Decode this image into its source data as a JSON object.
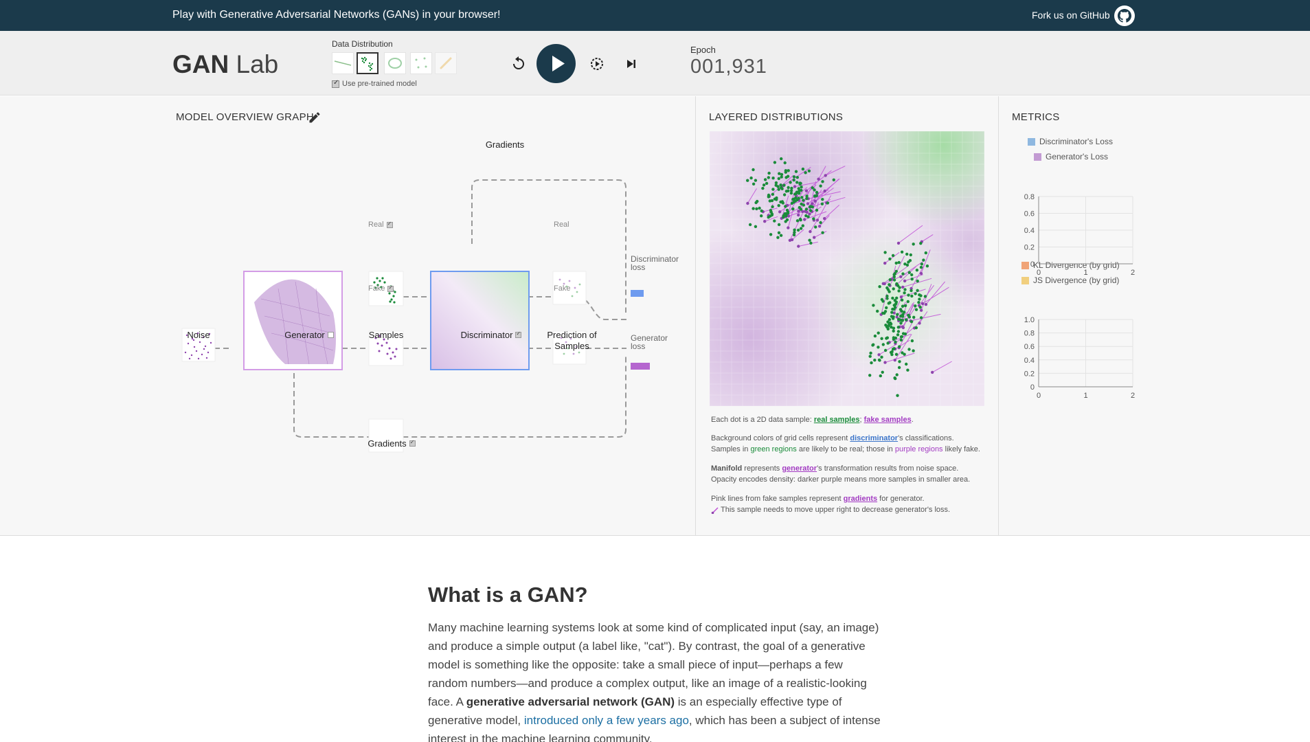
{
  "banner": {
    "message": "Play with Generative Adversarial Networks (GANs) in your browser!",
    "fork_label": "Fork us on GitHub",
    "fork_icon": "github-icon"
  },
  "header": {
    "logo_bold": "GAN",
    "logo_light": "Lab",
    "data_distribution_label": "Data Distribution",
    "distributions": [
      {
        "name": "line",
        "icon": "line-distribution-icon",
        "selected": false
      },
      {
        "name": "two-clusters",
        "icon": "two-clusters-distribution-icon",
        "selected": true
      },
      {
        "name": "ring",
        "icon": "ring-distribution-icon",
        "selected": false
      },
      {
        "name": "gaussian-mixture",
        "icon": "gaussian-mixture-distribution-icon",
        "selected": false
      },
      {
        "name": "draw",
        "icon": "pencil-draw-icon",
        "selected": false
      }
    ],
    "pretrained_label": "Use pre-trained model",
    "controls": [
      "reset-icon",
      "play-icon",
      "slow-motion-icon",
      "step-icon"
    ],
    "epoch_label": "Epoch",
    "epoch_value": "001,931"
  },
  "model_overview": {
    "title": "MODEL OVERVIEW GRAPH",
    "edit_icon": "pencil-icon",
    "nodes": {
      "noise": "Noise",
      "generator": "Generator",
      "samples": "Samples",
      "discriminator": "Discriminator",
      "prediction_line1": "Prediction of",
      "prediction_line2": "Samples",
      "gradients_top": "Gradients",
      "gradients_bottom": "Gradients"
    },
    "real_label": "Real",
    "fake_label": "Fake",
    "real_label2": "Real",
    "fake_label2": "Fake",
    "disc_loss_line1": "Discriminator",
    "disc_loss_line2": "loss",
    "gen_loss_line1": "Generator",
    "gen_loss_line2": "loss",
    "colors": {
      "discriminator_loss": "#6e9bef",
      "generator_loss": "#b566cf",
      "real": "#1a8b3a",
      "fake": "#8e44ad"
    }
  },
  "layered": {
    "title": "LAYERED DISTRIBUTIONS",
    "note1_prefix": "Each dot is a 2D data sample: ",
    "note1_real": "real samples",
    "note1_sep": "; ",
    "note1_fake": "fake samples",
    "note1_suffix": ".",
    "note2_prefix": "Background colors of grid cells represent ",
    "note2_disc": "discriminator",
    "note2_suffix": "'s classifications.",
    "note3_prefix": "Samples in ",
    "note3_green": "green regions",
    "note3_mid": " are likely to be real; those in ",
    "note3_purple": "purple regions",
    "note3_suffix": " likely fake.",
    "note4_bold": "Manifold",
    "note4_mid": " represents ",
    "note4_gen": "generator",
    "note4_suffix": "'s transformation results from noise space.",
    "note5": "Opacity encodes density: darker purple means more samples in smaller area.",
    "note6_prefix": "Pink lines from fake samples represent ",
    "note6_grad": "gradients",
    "note6_suffix": " for generator.",
    "note7": "This sample needs to move upper right to decrease generator's loss."
  },
  "metrics": {
    "title": "METRICS",
    "chart1_legend": [
      "Discriminator's Loss",
      "Generator's Loss"
    ],
    "chart1_colors": [
      "#8fb8e0",
      "#c39bd3"
    ],
    "chart1_y_ticks": [
      "0.8",
      "0.6",
      "0.4",
      "0.2",
      "0"
    ],
    "chart1_x_ticks": [
      "0",
      "1",
      "2"
    ],
    "chart2_legend": [
      "KL Divergence (by grid)",
      "JS Divergence (by grid)"
    ],
    "chart2_colors": [
      "#f0a478",
      "#f1cf7e"
    ],
    "chart2_y_ticks": [
      "1.0",
      "0.8",
      "0.6",
      "0.4",
      "0.2",
      "0"
    ],
    "chart2_x_ticks": [
      "0",
      "1",
      "2"
    ]
  },
  "article": {
    "heading": "What is a GAN?",
    "p1_a": "Many machine learning systems look at some kind of complicated input (say, an image) and produce a simple output (a label like, \"cat\"). By contrast, the goal of a generative model is something like the opposite: take a small piece of input—perhaps a few random numbers—and produce a complex output, like an image of a realistic-looking face. A ",
    "p1_bold": "generative adversarial network (GAN)",
    "p1_b": " is an especially effective type of generative model, ",
    "p1_link": "introduced only a few years ago",
    "p1_c": ", which has been a subject of intense interest in the machine learning community."
  }
}
